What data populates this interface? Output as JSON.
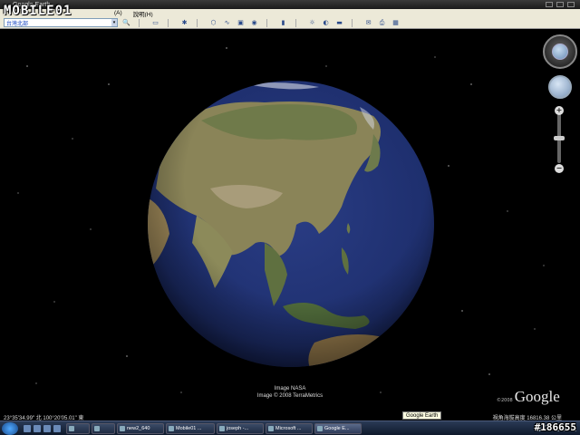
{
  "window": {
    "title": "Google Earth"
  },
  "watermark": {
    "logo_text": "MOBILE01",
    "post_id": "#186655"
  },
  "menubar": {
    "items": [
      "(A)",
      "說明(H)"
    ]
  },
  "toolbar": {
    "search_value": "台灣北部",
    "buttons": [
      "search-go",
      "sidebar-toggle",
      "placemark",
      "polygon",
      "path",
      "overlay",
      "record-tour",
      "sun",
      "planets",
      "ruler",
      "email",
      "print",
      "maps"
    ]
  },
  "viewport": {
    "credits": [
      "Image NASA",
      "Image © 2008 TerraMetrics"
    ],
    "brand_year": "©2008",
    "brand": "Google"
  },
  "navigation": {
    "zoom_in": "+",
    "zoom_out": "−"
  },
  "statusbar": {
    "coords": "23°35'34.99\" 北    100°20'05.01\" 東",
    "altitude": "視角海拔高度 16816.38 公里"
  },
  "taskbar": {
    "tasks": [
      "",
      "",
      "new2_640",
      "Mobile01 ...",
      "joseph -...",
      "Microsoft ...",
      "Google E..."
    ],
    "tooltip": "Google Earth",
    "tray_label": "CH"
  },
  "colors": {
    "ocean": "#1e2f6e",
    "land": "#8a8458",
    "space": "#000000",
    "menu_bg": "#ece9d8"
  }
}
